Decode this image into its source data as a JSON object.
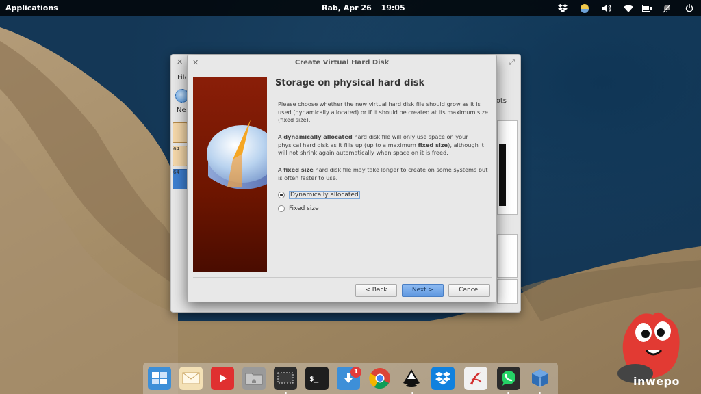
{
  "top_panel": {
    "apps_label": "Applications",
    "date": "Rab, Apr 26",
    "time": "19:05",
    "indicators": [
      "dropbox-icon",
      "weather-icon",
      "volume-icon",
      "wifi-icon",
      "battery-icon",
      "notifications-muted-icon",
      "power-icon"
    ]
  },
  "background_window": {
    "menu_file": "File",
    "toolbar_new": "New",
    "toolbar_snapshots": "Snapshots",
    "vm_badges": [
      "64",
      "64"
    ]
  },
  "dialog": {
    "title": "Create Virtual Hard Disk",
    "heading": "Storage on physical hard disk",
    "para1": "Please choose whether the new virtual hard disk file should grow as it is used (dynamically allocated) or if it should be created at its maximum size (fixed size).",
    "para2_pre": "A ",
    "para2_bold1": "dynamically allocated",
    "para2_mid": " hard disk file will only use space on your physical hard disk as it fills up (up to a maximum ",
    "para2_bold2": "fixed size",
    "para2_post": "), although it will not shrink again automatically when space on it is freed.",
    "para3_pre": "A ",
    "para3_bold": "fixed size",
    "para3_post": " hard disk file may take longer to create on some systems but is often faster to use.",
    "options": [
      {
        "label": "Dynamically allocated",
        "selected": true
      },
      {
        "label": "Fixed size",
        "selected": false
      }
    ],
    "back_label": "< Back",
    "next_label": "Next >",
    "cancel_label": "Cancel"
  },
  "dock": {
    "items": [
      "multitasking-view-icon",
      "mail-icon",
      "youtube-icon",
      "files-icon",
      "screenshot-icon",
      "terminal-icon",
      "downloads-icon",
      "chrome-icon",
      "inkscape-icon",
      "dropbox-icon",
      "pdf-reader-icon",
      "whatsapp-icon",
      "virtualbox-icon"
    ],
    "download_badge": "1",
    "terminal_label": "$_"
  },
  "watermark": {
    "text": "inwepo"
  },
  "colors": {
    "accent": "#5f98e0",
    "wizard_red": "#7a1a04",
    "panel": "#000000"
  }
}
